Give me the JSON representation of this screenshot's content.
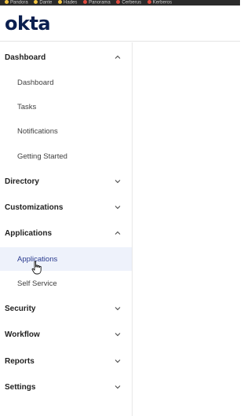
{
  "bookmarks": [
    {
      "label": "Pandora",
      "color": "#f4c542"
    },
    {
      "label": "Dante",
      "color": "#f4c542"
    },
    {
      "label": "Hades",
      "color": "#f4c542"
    },
    {
      "label": "Panorama",
      "color": "#e04b3f"
    },
    {
      "label": "Cerberus",
      "color": "#e04b3f"
    },
    {
      "label": "Kerberos",
      "color": "#e04b3f"
    }
  ],
  "brand": {
    "logo_text": "okta",
    "color": "#0b1f4f"
  },
  "sidebar": {
    "dashboard": {
      "label": "Dashboard",
      "expanded": true
    },
    "dashboard_items": [
      "Dashboard",
      "Tasks",
      "Notifications",
      "Getting Started"
    ],
    "directory": {
      "label": "Directory",
      "expanded": false
    },
    "customizations": {
      "label": "Customizations",
      "expanded": false
    },
    "applications": {
      "label": "Applications",
      "expanded": true
    },
    "applications_items": [
      "Applications",
      "Self Service"
    ],
    "security": {
      "label": "Security",
      "expanded": false
    },
    "workflow": {
      "label": "Workflow",
      "expanded": false
    },
    "reports": {
      "label": "Reports",
      "expanded": false
    },
    "settings": {
      "label": "Settings",
      "expanded": false
    },
    "active_item": "Applications"
  },
  "colors": {
    "active_bg": "#eef2fb",
    "active_text": "#2a3b8f"
  }
}
